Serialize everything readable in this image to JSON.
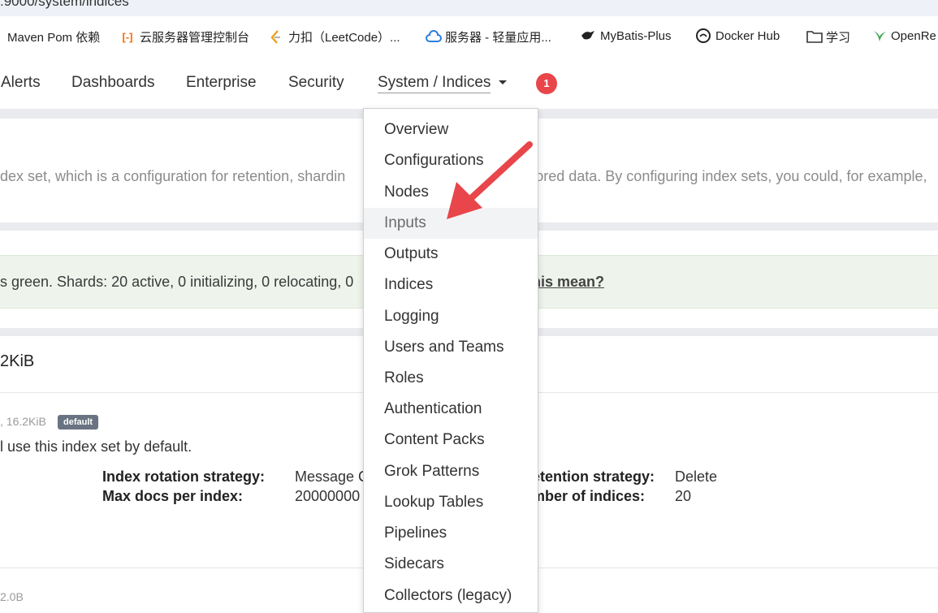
{
  "browser": {
    "url_fragment": ":9000/system/indices",
    "bookmarks": [
      {
        "label": "Maven Pom 依赖",
        "icon": "none"
      },
      {
        "label": "云服务器管理控制台",
        "icon": "aliyun-icon"
      },
      {
        "label": "力扣（LeetCode）...",
        "icon": "leetcode-icon"
      },
      {
        "label": "服务器 - 轻量应用...",
        "icon": "cloud-icon"
      },
      {
        "label": "MyBatis-Plus",
        "icon": "bird-icon"
      },
      {
        "label": "Docker Hub",
        "icon": "docker-icon"
      },
      {
        "label": "学习",
        "icon": "folder-icon"
      },
      {
        "label": "OpenRe",
        "icon": "openresty-icon"
      }
    ]
  },
  "nav": {
    "items": [
      "Alerts",
      "Dashboards",
      "Enterprise",
      "Security"
    ],
    "active": "System / Indices",
    "notification_count": "1"
  },
  "page": {
    "description": "dex set, which is a configuration for retention, shardin",
    "description_tail": "ored data. By configuring index sets, you could, for example,",
    "health_text": "s green. Shards: 20 active, 0 initializing, 0 relocating, 0",
    "health_link": "his mean?",
    "total_size": "2KiB",
    "index_set": {
      "meta": ", 16.2KiB",
      "badge": "default",
      "usage": "l use this index set by default.",
      "rotation_label": "Index rotation strategy:",
      "rotation_value": "Message C",
      "maxdocs_label": "Max docs per index:",
      "maxdocs_value": "20000000",
      "retention_label": "etention strategy:",
      "retention_value": "Delete",
      "numindices_label": "mber of indices:",
      "numindices_value": "20"
    },
    "next_meta": "2.0B"
  },
  "dropdown": {
    "items": [
      "Overview",
      "Configurations",
      "Nodes",
      "Inputs",
      "Outputs",
      "Indices",
      "Logging",
      "Users and Teams",
      "Roles",
      "Authentication",
      "Content Packs",
      "Grok Patterns",
      "Lookup Tables",
      "Pipelines",
      "Sidecars",
      "Collectors (legacy)"
    ],
    "hovered": "Inputs"
  },
  "colors": {
    "accent_arrow": "#e8464a",
    "badge": "#e8464a",
    "health_bg": "#eef4ec"
  }
}
